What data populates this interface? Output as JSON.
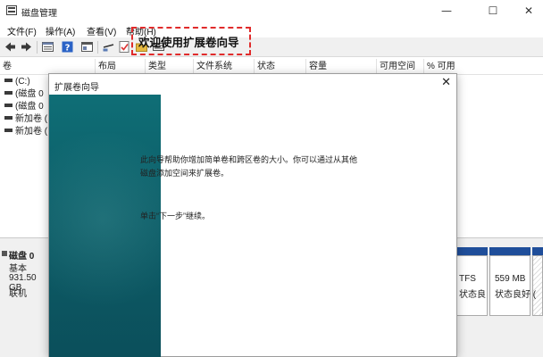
{
  "window": {
    "title": "磁盘管理",
    "controls": {
      "minimize": "—",
      "maximize": "☐",
      "close": "✕"
    }
  },
  "menu": [
    "文件(F)",
    "操作(A)",
    "查看(V)",
    "帮助(H)"
  ],
  "toolbar": {
    "icons": [
      "back-arrow-icon",
      "forward-arrow-icon",
      "disk-list-icon",
      "help-icon",
      "properties-icon",
      "connect-icon",
      "checkmark-icon",
      "folder-icon",
      "drive-icon"
    ]
  },
  "volume_table": {
    "columns": [
      "卷",
      "布局",
      "类型",
      "文件系统",
      "状态",
      "容量",
      "可用空间",
      "% 可用"
    ],
    "rows": [
      "(C:)",
      "(磁盘 0",
      "(磁盘 0",
      "新加卷 (",
      "新加卷 ("
    ]
  },
  "disk": {
    "name": "磁盘 0",
    "type": "基本",
    "size": "931.50 GB",
    "status": "联机"
  },
  "partitions": [
    {
      "fs": "TFS",
      "status": "状态良"
    },
    {
      "size": "559 MB",
      "status": "状态良好 ("
    },
    {
      "size": "",
      "status": ""
    }
  ],
  "colors": {
    "partition_strip": "#1f4e9a",
    "dialog_banner": "#0d5f69",
    "highlight_border": "#e02b2b"
  },
  "wizard": {
    "title": "扩展卷向导",
    "close": "✕",
    "heading": "欢迎使用扩展卷向导",
    "desc_line1": "此向导帮助你增加简单卷和跨区卷的大小。你可以通过从其他",
    "desc_line2": "磁盘添加空间来扩展卷。",
    "next_hint": "单击“下一步”继续。"
  }
}
